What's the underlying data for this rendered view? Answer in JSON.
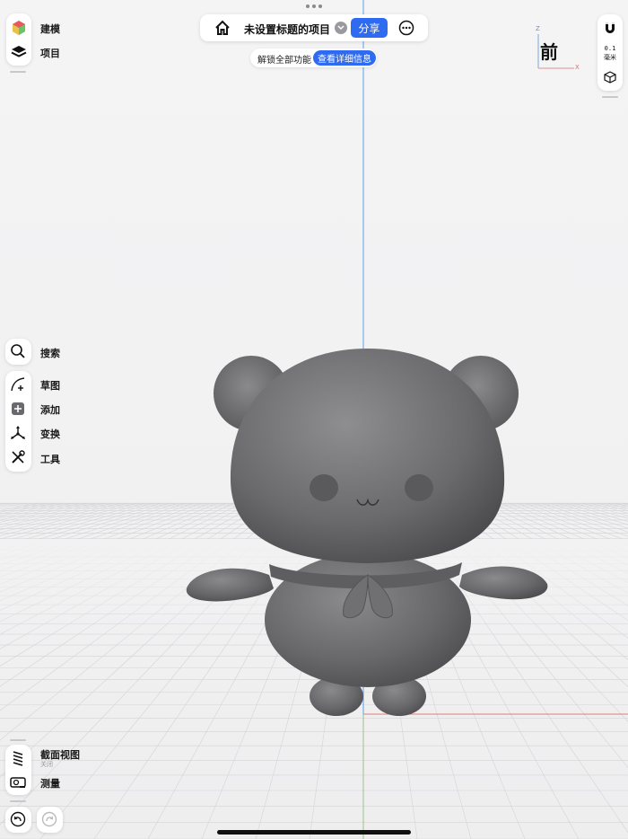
{
  "header": {
    "project_title": "未设置标题的项目",
    "share_label": "分享",
    "unlock_text": "解锁全部功能",
    "unlock_details_label": "查看详细信息"
  },
  "left_top": {
    "modeling_label": "建模",
    "project_label": "项目"
  },
  "left_tools": {
    "search_label": "搜索",
    "sketch_label": "草图",
    "add_label": "添加",
    "transform_label": "变换",
    "tools_label": "工具"
  },
  "left_bottom": {
    "section_view_label": "截面视图",
    "section_view_status": "关闭",
    "measure_label": "测量"
  },
  "right_panel": {
    "snap_value": "0.1",
    "snap_unit": "毫米"
  },
  "view_cube": {
    "face_label": "前",
    "axis_z": "Z",
    "axis_x": "X"
  },
  "colors": {
    "accent": "#2f6bf0",
    "model": "#6b6b6e",
    "axis_vertical": "#5aa0e6",
    "axis_horizontal": "#e07a7a"
  },
  "icons": [
    "modeling-cube-icon",
    "layers-icon",
    "home-icon",
    "chevron-down-icon",
    "more-icon",
    "search-icon",
    "sketch-icon",
    "add-icon",
    "transform-icon",
    "tools-icon",
    "section-view-icon",
    "measure-icon",
    "undo-icon",
    "redo-icon",
    "magnet-icon",
    "view-cube-small-icon"
  ]
}
